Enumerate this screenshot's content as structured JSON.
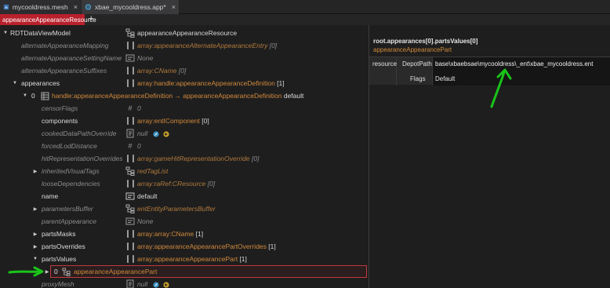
{
  "tabs": [
    {
      "label": "mycooldress.mesh",
      "close": "×",
      "icon": "mesh-file-icon"
    },
    {
      "label": "xbae_mycooldress.app*",
      "close": "×",
      "icon": "gear-icon"
    }
  ],
  "subtab": {
    "label": "appearanceAppearanceResource",
    "add": "+"
  },
  "tree": {
    "root": {
      "name": "RDTDataViewModel",
      "value": "appearanceAppearanceResource"
    },
    "rows": [
      {
        "name": "alternateAppearanceMapping",
        "value": "array:appearanceAlternateAppearanceEntry",
        "count": "[0]"
      },
      {
        "name": "alternateAppearanceSettingName",
        "value": "None"
      },
      {
        "name": "alternateAppearanceSuffixes",
        "value": "array:CName",
        "count": "[0]"
      },
      {
        "name": "appearances",
        "value": "array:handle:appearanceAppearanceDefinition",
        "count": "[1]"
      },
      {
        "index": "0",
        "value": "handle:appearanceAppearanceDefinition → appearanceAppearanceDefinition",
        "extra": "default"
      },
      {
        "name": "censorFlags",
        "value": "0"
      },
      {
        "name": "components",
        "value": "array:entIComponent",
        "count": "[0]"
      },
      {
        "name": "cookedDataPathOverride",
        "value": "null"
      },
      {
        "name": "forcedLodDistance",
        "value": "0"
      },
      {
        "name": "hitRepresentationOverrides",
        "value": "array:gameHitRepresentationOverride",
        "count": "[0]"
      },
      {
        "name": "inheritedVisualTags",
        "value": "redTagList"
      },
      {
        "name": "looseDependencies",
        "value": "array:raRef:CResource",
        "count": "[0]"
      },
      {
        "name": "name",
        "value": "default"
      },
      {
        "name": "parametersBuffer",
        "value": "entEntityParametersBuffer"
      },
      {
        "name": "parentAppearance",
        "value": "None"
      },
      {
        "name": "partsMasks",
        "value": "array:array:CName",
        "count": "[1]"
      },
      {
        "name": "partsOverrides",
        "value": "array:appearanceAppearancePartOverrides",
        "count": "[1]"
      },
      {
        "name": "partsValues",
        "value": "array:appearanceAppearancePart",
        "count": "[1]"
      },
      {
        "index": "0",
        "value": "appearanceAppearancePart"
      },
      {
        "name": "proxyMesh",
        "value": "null"
      }
    ]
  },
  "inspector": {
    "path": "root.appearances[0].partsValues[0]",
    "type": "appearanceAppearancePart",
    "field": "resource",
    "sub1_label": "DepotPath",
    "sub1_value": "base\\xbaebsae\\mycooldress\\_ent\\xbae_mycooldress.ent",
    "sub2_label": "Flags",
    "sub2_value": "Default"
  },
  "colors": {
    "accent": "#b8202c",
    "highlight": "#c0393b",
    "type_orange": "#d28a3c",
    "arrow_green": "#19c419"
  }
}
